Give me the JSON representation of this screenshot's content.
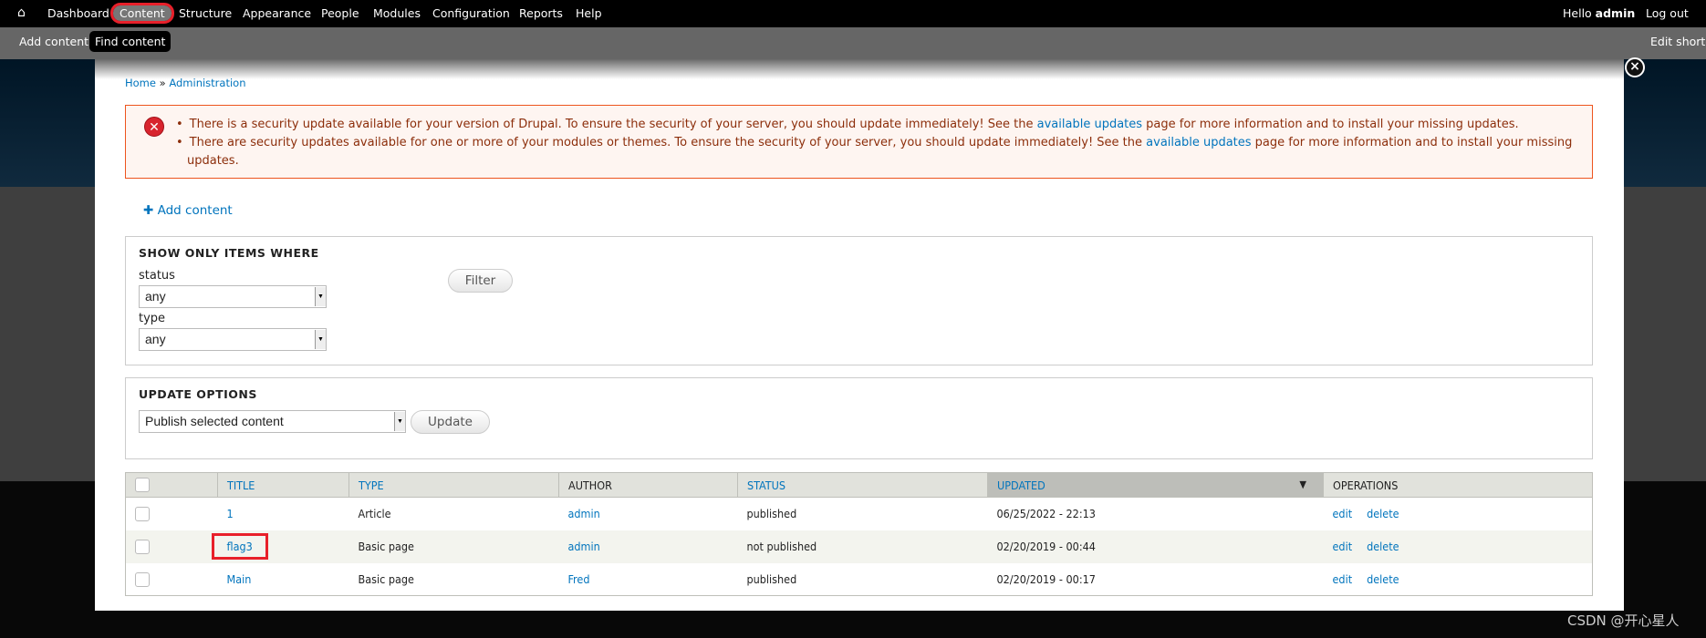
{
  "toolbar": {
    "home_icon": "home-icon",
    "items": [
      "Dashboard",
      "Content",
      "Structure",
      "Appearance",
      "People",
      "Modules",
      "Configuration",
      "Reports",
      "Help"
    ],
    "active": "Content",
    "hello": "Hello ",
    "user": "admin",
    "logout": "Log out"
  },
  "shortcuts": {
    "items": [
      "Add content",
      "Find content"
    ],
    "active": "Find content",
    "edit": "Edit shortcuts"
  },
  "overlay": {
    "close_icon": "close-icon",
    "breadcrumb": {
      "home": "Home",
      "sep": " » ",
      "admin": "Administration"
    },
    "messages": {
      "icon": "error-icon",
      "items": [
        {
          "pre": "There is a security update available for your version of Drupal. To ensure the security of your server, you should update immediately! See the ",
          "link": "available updates",
          "post": " page for more information and to install your missing updates."
        },
        {
          "pre": "There are security updates available for one or more of your modules or themes. To ensure the security of your server, you should update immediately! See the ",
          "link": "available updates",
          "post": " page for more information and to install your missing updates."
        }
      ]
    },
    "add_content": "Add content",
    "filter": {
      "legend": "SHOW ONLY ITEMS WHERE",
      "status_label": "status",
      "status_value": "any",
      "type_label": "type",
      "type_value": "any",
      "button": "Filter"
    },
    "update": {
      "legend": "UPDATE OPTIONS",
      "value": "Publish selected content",
      "button": "Update"
    },
    "table": {
      "headers": [
        "TITLE",
        "TYPE",
        "AUTHOR",
        "STATUS",
        "UPDATED",
        "OPERATIONS"
      ],
      "sorted_by": "UPDATED",
      "sort_direction": "descending",
      "rows": [
        {
          "title": "1",
          "type": "Article",
          "author": "admin",
          "status": "published",
          "updated": "06/25/2022 - 22:13",
          "edit": "edit",
          "delete": "delete"
        },
        {
          "title": "flag3",
          "type": "Basic page",
          "author": "admin",
          "status": "not published",
          "updated": "02/20/2019 - 00:44",
          "edit": "edit",
          "delete": "delete",
          "highlighted": true
        },
        {
          "title": "Main",
          "type": "Basic page",
          "author": "Fred",
          "status": "published",
          "updated": "02/20/2019 - 00:17",
          "edit": "edit",
          "delete": "delete"
        }
      ]
    }
  },
  "watermark": "CSDN @开心星人",
  "colors": {
    "link": "#0074bd",
    "error_border": "#ed541d",
    "error_bg": "#fef5f1",
    "highlight": "#e8202a"
  }
}
